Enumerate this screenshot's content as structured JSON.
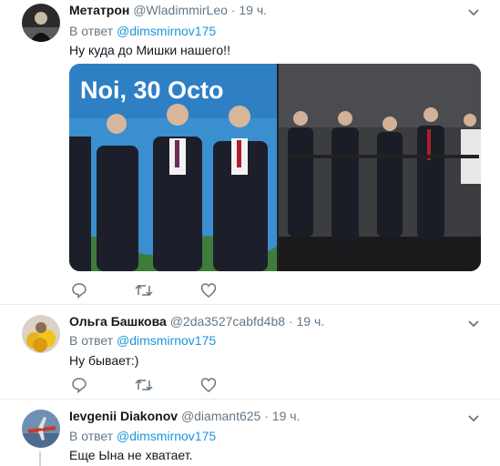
{
  "tweets": [
    {
      "name": "Метатрон",
      "handle": "@WladimmirLeo",
      "dot": "·",
      "time": "19 ч.",
      "reply_prefix": "В ответ",
      "reply_mention": "@dimsmirnov175",
      "text": "Ну куда до Мишки нашего!!",
      "media_caption": "Noi, 30 Octo"
    },
    {
      "name": "Ольга Башкова",
      "handle": "@2da3527cabfd4b8",
      "dot": "·",
      "time": "19 ч.",
      "reply_prefix": "В ответ",
      "reply_mention": "@dimsmirnov175",
      "text": "Ну бывает:)"
    },
    {
      "name": "Ievgenii Diakonov",
      "handle": "@diamant625",
      "dot": "·",
      "time": "19 ч.",
      "reply_prefix": "В ответ",
      "reply_mention": "@dimsmirnov175",
      "text": "Еще Ына не хватает."
    }
  ],
  "icons": {
    "reply": "reply-icon",
    "retweet": "retweet-icon",
    "like": "like-icon",
    "more": "chevron-down-icon"
  },
  "colors": {
    "link": "#1b95e0",
    "muted": "#657786",
    "text": "#14171a",
    "divider": "#e6ecf0"
  }
}
